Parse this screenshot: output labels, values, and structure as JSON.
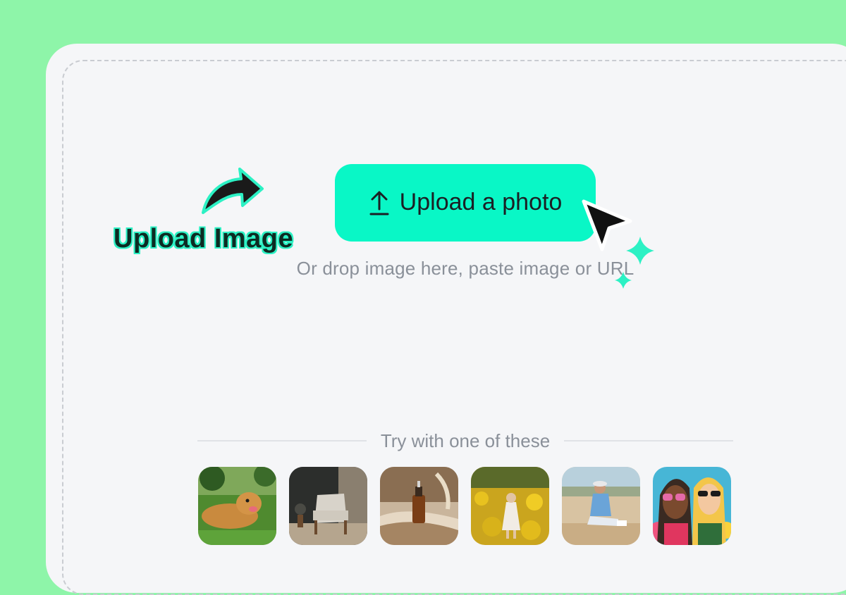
{
  "upload": {
    "button_label": "Upload a photo",
    "subtitle": "Or drop image here, paste image or URL"
  },
  "annotation": {
    "label": "Upload Image"
  },
  "samples": {
    "heading": "Try with one of these",
    "items": [
      {
        "name": "dog-photo-thumbnail"
      },
      {
        "name": "armchair-photo-thumbnail"
      },
      {
        "name": "bottle-photo-thumbnail"
      },
      {
        "name": "flower-field-photo-thumbnail"
      },
      {
        "name": "seated-person-photo-thumbnail"
      },
      {
        "name": "illustration-thumbnail"
      }
    ]
  },
  "colors": {
    "background": "#8ef5a9",
    "accent": "#09f7c6",
    "card": "#f5f6f8"
  },
  "icons": [
    "upload-arrow-icon",
    "curved-arrow-icon",
    "cursor-icon",
    "sparkle-icon"
  ]
}
